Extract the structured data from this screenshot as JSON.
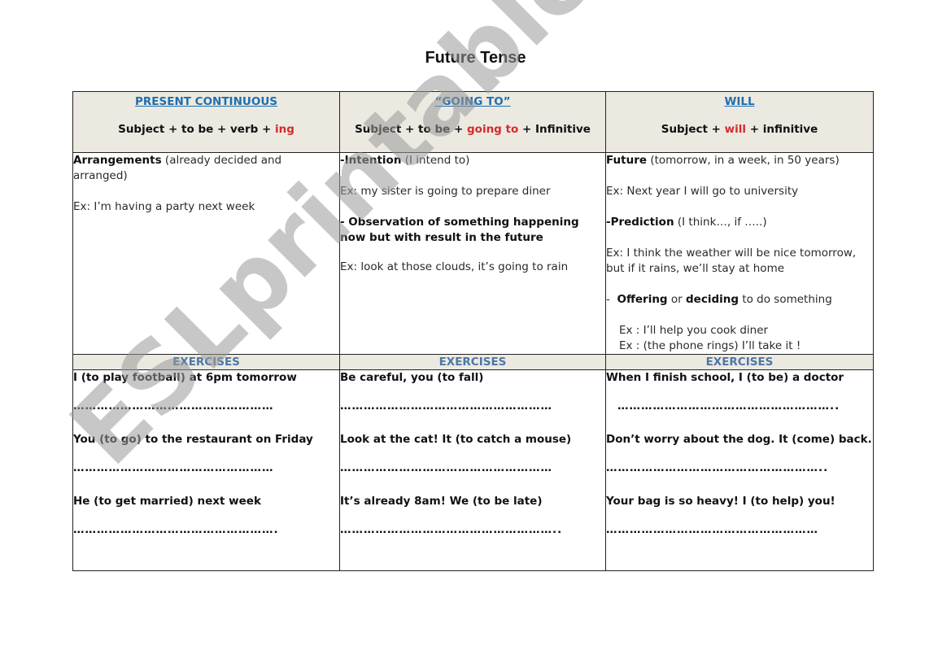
{
  "document": {
    "title": "Future Tense",
    "watermark": "ESLprintables.com"
  },
  "colors": {
    "header_title": "#1f6fae",
    "highlight_red": "#d42a2a",
    "exercises_label": "#4e77a6",
    "header_bg": "#ece9e1"
  },
  "columns": [
    {
      "title": "PRESENT CONTINUOUS",
      "formula_parts": [
        "Subject  + to be + verb + ",
        "ing"
      ],
      "usage": [
        {
          "bold": "Arrangements",
          "rest": " (already decided and arranged)"
        },
        {
          "example": "Ex: I’m having a party next week"
        }
      ],
      "exercises_label": "EXERCISES",
      "exercises": [
        {
          "question": "I (to play football) at 6pm tomorrow",
          "blank": "……………………………………………"
        },
        {
          "question": "You (to go) to the restaurant on Friday",
          "blank": "……………………………………………"
        },
        {
          "question": "He (to get married) next week",
          "blank": "……………………………………………."
        }
      ]
    },
    {
      "title": "“GOING TO”",
      "formula_parts": [
        "Subject + to be  + ",
        "going  to",
        " + Infinitive"
      ],
      "usage": [
        {
          "bold": "-Intention",
          "rest": " (I intend to)"
        },
        {
          "example": "Ex: my sister is going to prepare diner"
        },
        {
          "bold": "- Observation of something happening now but with result in the future",
          "rest": ""
        },
        {
          "example": "Ex: look at those clouds, it’s going to rain"
        }
      ],
      "exercises_label": "EXERCISES",
      "exercises": [
        {
          "question": "Be careful, you (to fall)",
          "blank": "………………………………………………"
        },
        {
          "question": "Look at the cat! It (to catch a mouse)",
          "blank": "………………………………………………"
        },
        {
          "question": "It’s already 8am! We (to be late)",
          "blank": "……………………………………………….."
        }
      ]
    },
    {
      "title": "WILL",
      "formula_parts": [
        "Subject + ",
        "will",
        " + infinitive"
      ],
      "usage": [
        {
          "bold": "Future",
          "rest": " (tomorrow, in a week, in 50 years)"
        },
        {
          "example": "Ex: Next year I will go to university"
        },
        {
          "bold": "-Prediction",
          "rest": " (I think…, if …..)"
        },
        {
          "example": "Ex: I think the weather will be nice tomorrow, but if it rains, we’ll stay at home"
        },
        {
          "prefix": "-  ",
          "bold": "Offering",
          "mid": " or ",
          "bold2": "deciding",
          "rest": " to do something"
        },
        {
          "example": "Ex : I’ll help you cook diner"
        },
        {
          "example": "Ex : (the phone rings) I’ll take it !"
        }
      ],
      "exercises_label": "EXERCISES",
      "exercises": [
        {
          "question": "When I finish school, I (to be) a doctor",
          "blank": "……………………………………………….."
        },
        {
          "question": "Don’t worry about the dog. It (come) back.",
          "blank": "……………………………………………….."
        },
        {
          "question": "Your bag is so heavy! I (to help) you!",
          "blank": "………………………………………………"
        }
      ]
    }
  ]
}
